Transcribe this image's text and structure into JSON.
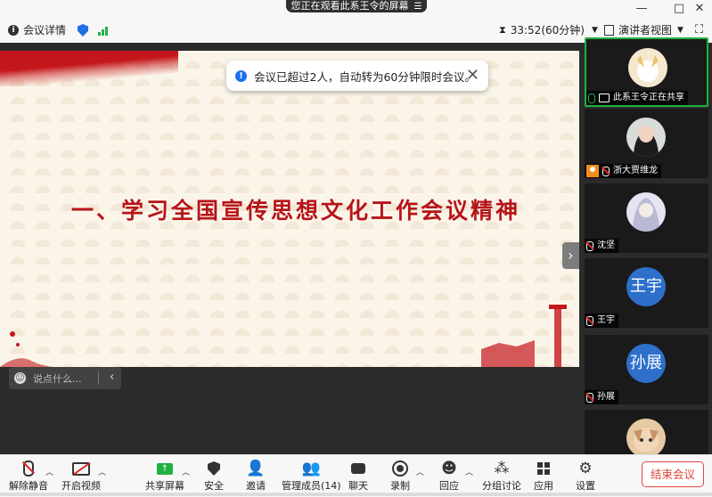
{
  "banner": {
    "text": "您正在观看此系王令的屏幕",
    "icon": "menu-icon"
  },
  "window": {
    "min": "—",
    "max": "□",
    "close": "✕"
  },
  "infobar": {
    "meeting_info": "会议详情",
    "timer": "33:52(60分钟)",
    "view_mode": "演讲者视图"
  },
  "notice": {
    "text": "会议已超过2人，自动转为60分钟限时会议。"
  },
  "slide": {
    "title": "一、学习全国宣传思想文化工作会议精神"
  },
  "chat": {
    "placeholder": "说点什么..."
  },
  "gallery": [
    {
      "name": "此系王令正在共享"
    },
    {
      "name": "浙大贾维龙"
    },
    {
      "name": "沈坚"
    },
    {
      "name": "王宇",
      "initial": "王宇"
    },
    {
      "name": "孙展",
      "initial": "孙展"
    },
    {
      "name": ""
    }
  ],
  "toolbar": {
    "unmute": "解除静音",
    "video": "开启视频",
    "share": "共享屏幕",
    "security": "安全",
    "invite": "邀请",
    "participants": "管理成员(14)",
    "chat": "聊天",
    "record": "录制",
    "reactions": "回应",
    "breakout": "分组讨论",
    "apps": "应用",
    "settings": "设置",
    "end": "结束会议"
  },
  "colors": {
    "accent": "#1a6ff0",
    "end": "#e0463e",
    "active_speaker": "#1fb141",
    "slide_title": "#b6141a"
  }
}
